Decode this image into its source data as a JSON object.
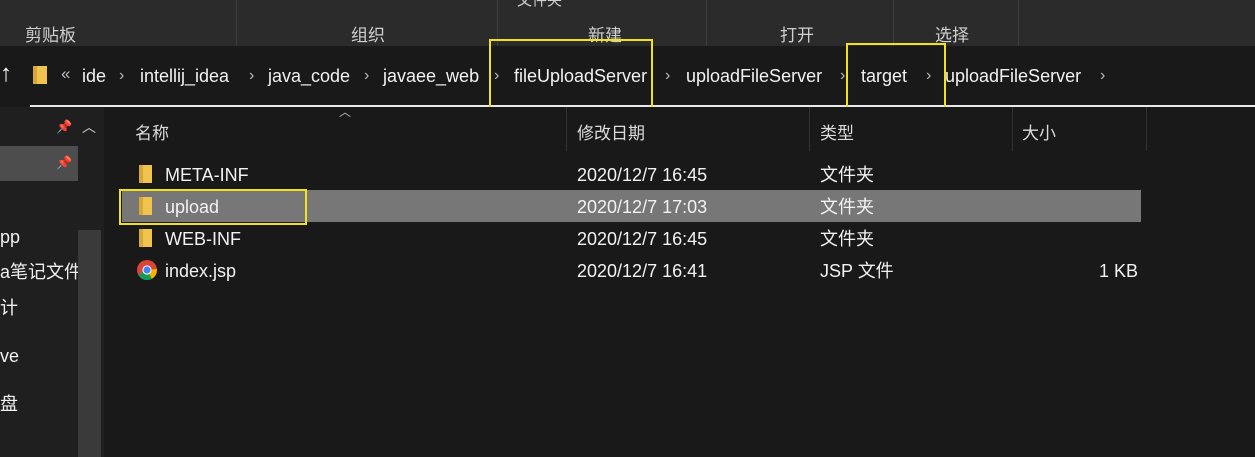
{
  "ribbon": {
    "groups": [
      "剪贴板",
      "组织",
      "新建",
      "打开",
      "选择"
    ],
    "cut_top_text": "文件夹"
  },
  "address": {
    "overflow": "«",
    "crumbs": [
      "ide",
      "intellij_idea",
      "java_code",
      "javaee_web",
      "fileUploadServer",
      "uploadFileServer",
      "target",
      "uploadFileServer"
    ],
    "separator": "›"
  },
  "nav": {
    "items": [
      "pp",
      "a笔记文件",
      "计",
      "ve",
      "盘"
    ]
  },
  "columns": {
    "name": "名称",
    "modified": "修改日期",
    "type": "类型",
    "size": "大小"
  },
  "files": [
    {
      "name": "META-INF",
      "modified": "2020/12/7 16:45",
      "type": "文件夹",
      "size": "",
      "icon": "folder-icon"
    },
    {
      "name": "upload",
      "modified": "2020/12/7 17:03",
      "type": "文件夹",
      "size": "",
      "icon": "folder-icon",
      "selected": true
    },
    {
      "name": "WEB-INF",
      "modified": "2020/12/7 16:45",
      "type": "文件夹",
      "size": "",
      "icon": "folder-icon"
    },
    {
      "name": "index.jsp",
      "modified": "2020/12/7 16:41",
      "type": "JSP 文件",
      "size": "1 KB",
      "icon": "chrome-icon"
    }
  ],
  "colors": {
    "highlight": "#f3e21a",
    "selected_row": "#777777",
    "folder": "#f0c34e",
    "background": "#191919"
  }
}
